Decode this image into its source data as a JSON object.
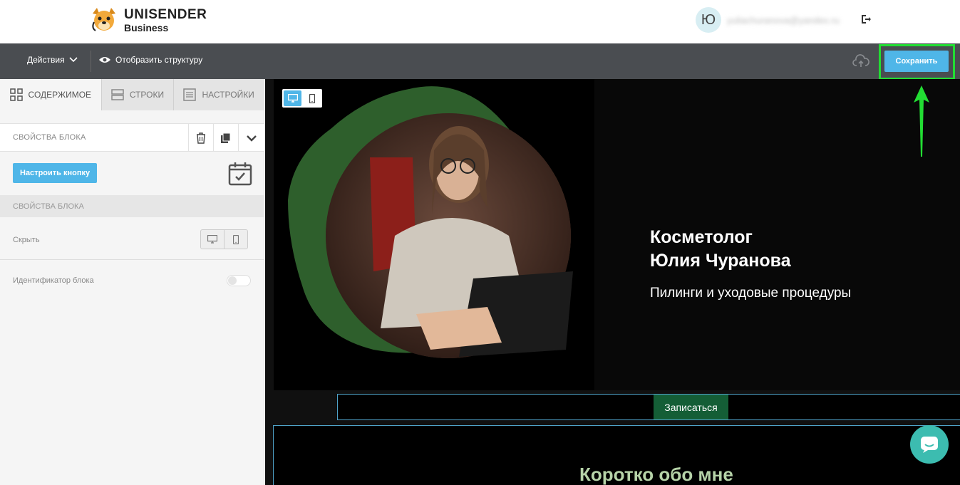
{
  "header": {
    "logo_brand": "UNISENDER",
    "logo_sub": "Business",
    "avatar_initial": "Ю",
    "user_email": "yuliachuranova@yandex.ru",
    "logout_icon": "logout-icon"
  },
  "toolbar": {
    "actions_label": "Действия",
    "structure_label": "Отобразить структуру",
    "save_label": "Сохранить",
    "cloud_icon": "cloud-upload-icon"
  },
  "sidebar": {
    "tabs": [
      {
        "label": "СОДЕРЖИМОЕ",
        "icon": "grid-icon",
        "active": true
      },
      {
        "label": "СТРОКИ",
        "icon": "rows-icon",
        "active": false
      },
      {
        "label": "НАСТРОЙКИ",
        "icon": "settings-icon",
        "active": false
      }
    ],
    "block_props_title": "СВОЙСТВА БЛОКА",
    "configure_button_label": "Настроить кнопку",
    "block_props_title_2": "СВОЙСТВА БЛОКА",
    "hide_label": "Скрыть",
    "block_id_label": "Идентификатор блока"
  },
  "canvas": {
    "hero_title_line1": "Косметолог",
    "hero_title_line2": "Юлия Чуранова",
    "hero_subtitle": "Пилинги и уходовые процедуры",
    "signup_button_label": "Записаться",
    "about_title": "Коротко обо мне"
  },
  "colors": {
    "accent": "#4fb6e8",
    "toolbar": "#4a4d51",
    "highlight": "#22dd33",
    "signup_green": "#145e36",
    "about_text": "#b6d3a8",
    "chat": "#3cbcb0"
  }
}
